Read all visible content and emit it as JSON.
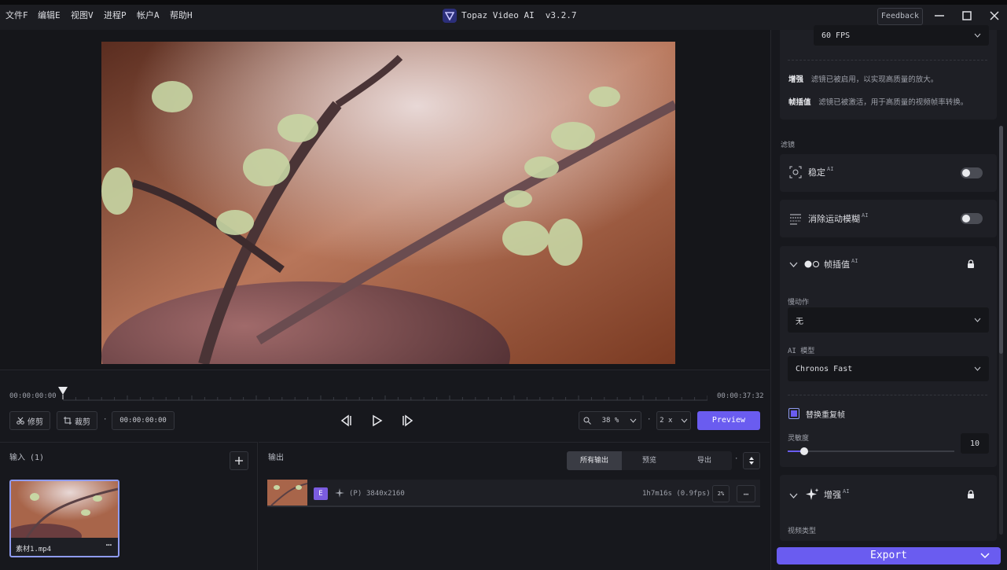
{
  "menu": [
    "文件F",
    "编辑E",
    "视图V",
    "进程P",
    "帐户A",
    "帮助H"
  ],
  "app": {
    "title": "Topaz Video AI",
    "version": "v3.2.7",
    "feedback": "Feedback"
  },
  "timeline": {
    "start": "00:00:00:00",
    "end": "00:00:37:32",
    "trim_label": "修剪",
    "crop_label": "裁剪",
    "separator": "·",
    "current_time": "00:00:00:00",
    "zoom": "38 %",
    "speed": "2 x",
    "preview_label": "Preview"
  },
  "input": {
    "title": "输入 (1)",
    "file_name": "素材1.mp4"
  },
  "output": {
    "title": "输出",
    "tabs": [
      "所有输出",
      "预览",
      "导出"
    ],
    "row": {
      "badge": "E",
      "mode": "(P)",
      "resolution": "3840x2160",
      "duration": "1h7m16s (0.9fps)",
      "percent": "2%"
    }
  },
  "right": {
    "fps_value": "60 FPS",
    "enhance_note_label": "增强",
    "enhance_note": "滤镜已被启用，以实现高质量的放大。",
    "interp_note_label": "帧插值",
    "interp_note": "滤镜已被激活，用于高质量的视频帧率转换。",
    "filters_title": "滤镜",
    "stabilize": "稳定",
    "motion_blur": "消除运动模糊",
    "ai_sup": "AI",
    "frame_interp": "帧插值",
    "slowmo_label": "慢动作",
    "slowmo_value": "无",
    "ai_model_label": "AI 模型",
    "ai_model_value": "Chronos Fast",
    "replace_dup_label": "替换重复帧",
    "sensitivity_label": "灵敏度",
    "sensitivity_value": "10",
    "sensitivity_level": 0.1,
    "enhance_title": "增强",
    "video_type_label": "视频类型",
    "export_label": "Export"
  },
  "colors": {
    "accent": "#6a5cf0",
    "bg": "#16171c",
    "panel": "#1e1f25"
  }
}
